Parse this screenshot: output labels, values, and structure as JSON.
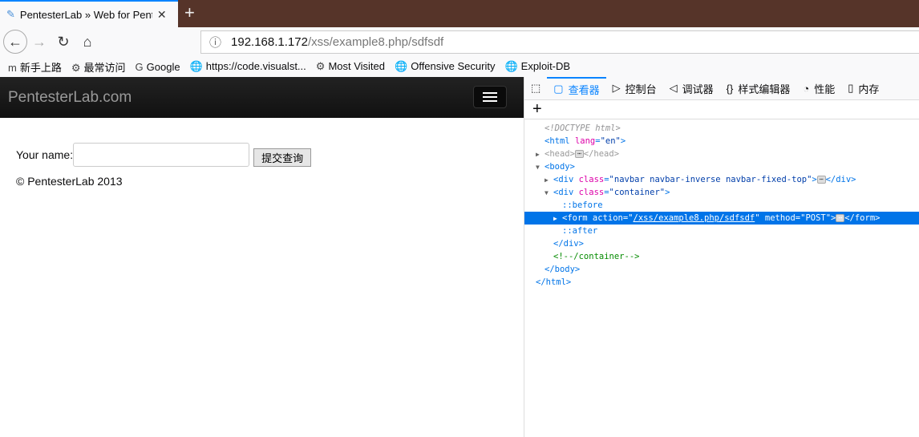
{
  "browser": {
    "tab_title": "PentesterLab » Web for Pent",
    "url_host": "192.168.1.172",
    "url_path": "/xss/example8.php/sdfsdf",
    "bookmarks": [
      {
        "icon": "m",
        "label": "新手上路"
      },
      {
        "icon": "⚙",
        "label": "最常访问"
      },
      {
        "icon": "G",
        "label": "Google"
      },
      {
        "icon": "🌐",
        "label": "https://code.visualst..."
      },
      {
        "icon": "⚙",
        "label": "Most Visited"
      },
      {
        "icon": "🌐",
        "label": "Offensive Security"
      },
      {
        "icon": "🌐",
        "label": "Exploit-DB"
      }
    ]
  },
  "page": {
    "brand": "PentesterLab.com",
    "name_label": "Your name:",
    "name_value": "",
    "submit": "提交查询",
    "copyright": "© PentesterLab 2013"
  },
  "devtools": {
    "tabs": [
      {
        "icon": "▢",
        "label": "查看器"
      },
      {
        "icon": "▷",
        "label": "控制台"
      },
      {
        "icon": "◁",
        "label": "调试器"
      },
      {
        "icon": "{}",
        "label": "样式编辑器"
      },
      {
        "icon": "◔",
        "label": "性能"
      },
      {
        "icon": "▯",
        "label": "内存"
      }
    ],
    "lines": [
      {
        "indent": 0,
        "tw": "",
        "sel": false,
        "segs": [
          [
            "c-doc",
            "<!DOCTYPE html>"
          ]
        ]
      },
      {
        "indent": 0,
        "tw": "",
        "sel": false,
        "segs": [
          [
            "",
            "<html "
          ],
          [
            "c-an",
            "lang"
          ],
          [
            "",
            "="
          ],
          [
            "c-av",
            "\"en\""
          ],
          [
            "",
            ">"
          ]
        ]
      },
      {
        "indent": 0,
        "tw": "▶",
        "sel": false,
        "segs": [
          [
            "c-dim",
            "<head>"
          ],
          [
            "ell",
            "⋯"
          ],
          [
            "c-dim",
            "</head>"
          ]
        ]
      },
      {
        "indent": 0,
        "tw": "▼",
        "sel": false,
        "segs": [
          [
            "",
            "<body>"
          ]
        ]
      },
      {
        "indent": 1,
        "tw": "▶",
        "sel": false,
        "segs": [
          [
            "",
            "<div "
          ],
          [
            "c-an",
            "class"
          ],
          [
            "",
            "="
          ],
          [
            "c-av",
            "\"navbar navbar-inverse navbar-fixed-top\""
          ],
          [
            "",
            ">"
          ],
          [
            "ell",
            "⋯"
          ],
          [
            "",
            "</div>"
          ]
        ]
      },
      {
        "indent": 1,
        "tw": "▼",
        "sel": false,
        "segs": [
          [
            "",
            "<div "
          ],
          [
            "c-an",
            "class"
          ],
          [
            "",
            "="
          ],
          [
            "c-av",
            "\"container\""
          ],
          [
            "",
            ">"
          ]
        ]
      },
      {
        "indent": 2,
        "tw": "",
        "sel": false,
        "segs": [
          [
            "c-ps",
            "::before"
          ]
        ]
      },
      {
        "indent": 2,
        "tw": "▶",
        "sel": true,
        "segs": [
          [
            "",
            "<form action=\""
          ],
          [
            "u",
            "/xss/example8.php/sdfsdf"
          ],
          [
            "",
            "\" method=\"POST\">"
          ],
          [
            "ell",
            "⋯"
          ],
          [
            "",
            "</form>"
          ]
        ]
      },
      {
        "indent": 2,
        "tw": "",
        "sel": false,
        "segs": [
          [
            "c-ps",
            "::after"
          ]
        ]
      },
      {
        "indent": 1,
        "tw": "",
        "sel": false,
        "segs": [
          [
            "",
            "</div>"
          ]
        ]
      },
      {
        "indent": 1,
        "tw": "",
        "sel": false,
        "segs": [
          [
            "c-cm",
            "<!--/container-->"
          ]
        ]
      },
      {
        "indent": 0,
        "tw": "",
        "sel": false,
        "segs": [
          [
            "",
            "</body>"
          ]
        ]
      },
      {
        "indent": -1,
        "tw": "",
        "sel": false,
        "segs": [
          [
            "",
            "</html>"
          ]
        ]
      }
    ]
  }
}
